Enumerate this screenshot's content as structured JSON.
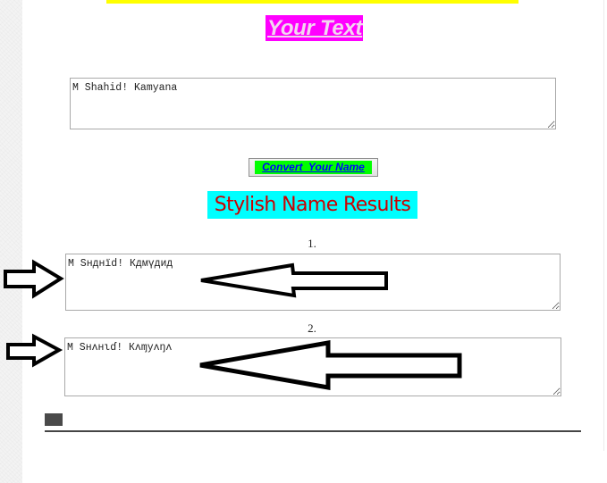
{
  "header": {
    "banner_color": "#ffff00",
    "title": "Your Text",
    "title_bg": "#ff00ff"
  },
  "input": {
    "value": "M Shahid! Kamyana",
    "placeholder": ""
  },
  "convert_button": {
    "label": "Convert  Your Name",
    "bg": "#00ff00",
    "text_color": "#0000ff"
  },
  "results": {
    "heading": "Stylish Name Results",
    "heading_bg": "#00ffff",
    "heading_color": "#cc0000",
    "items": [
      {
        "number": "1.",
        "value": "M Sнднïd! Кдмүдид"
      },
      {
        "number": "2.",
        "value": "M Sнʌнιɗ! Кʌɱуʌŋʌ"
      }
    ]
  },
  "annotations": {
    "arrow_icons": [
      "right-arrow-icon",
      "left-arrow-icon",
      "right-arrow-icon",
      "left-arrow-icon"
    ]
  }
}
